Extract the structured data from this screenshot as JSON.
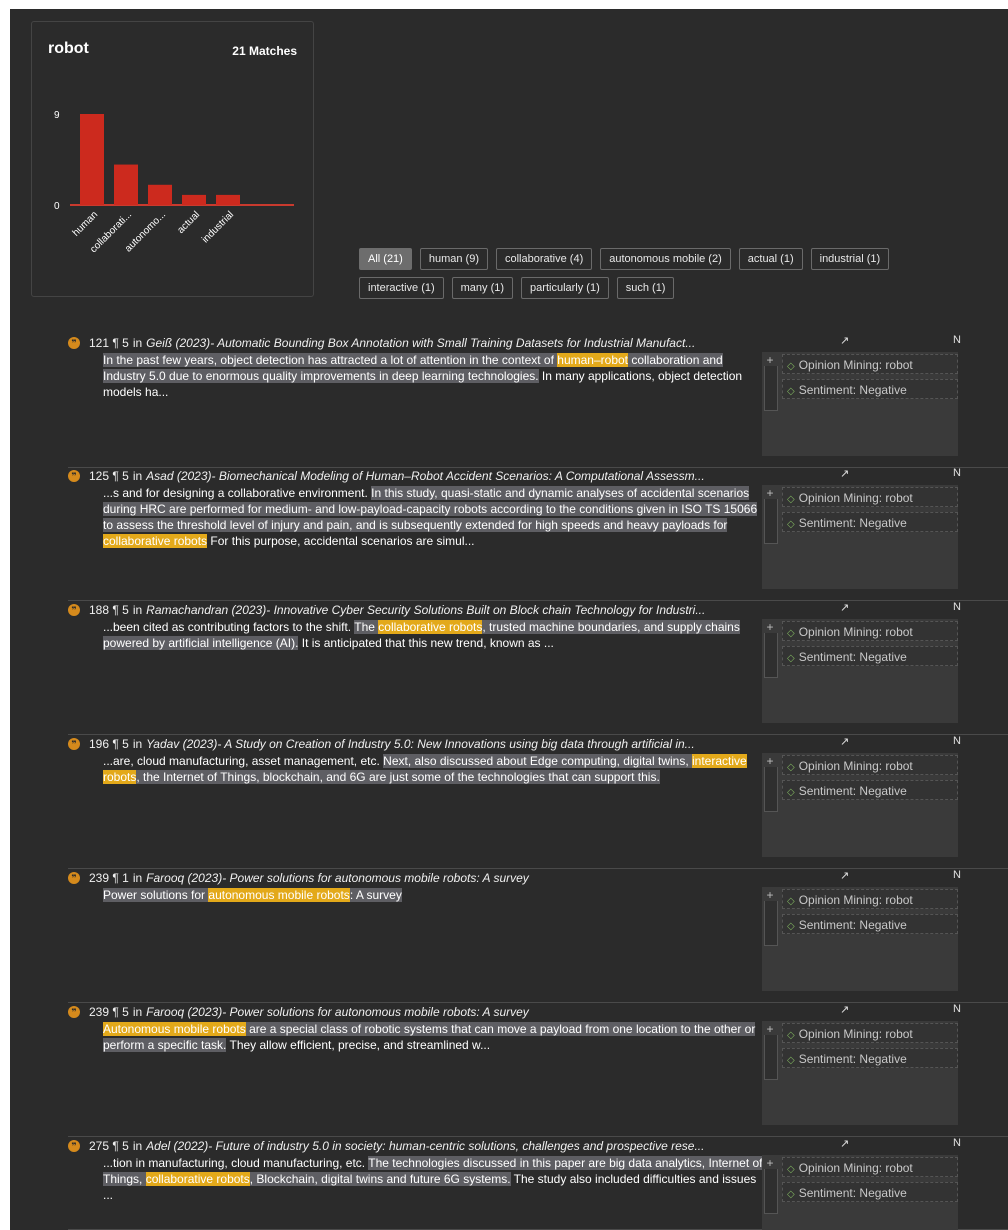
{
  "summary": {
    "term": "robot",
    "matches_label": "21 Matches",
    "chart_data": {
      "type": "bar",
      "categories": [
        "human",
        "collaborati...",
        "autonomo...",
        "actual",
        "industrial"
      ],
      "values": [
        9,
        4,
        2,
        1,
        1
      ],
      "ylim": [
        0,
        9
      ],
      "ytick_labels": [
        "0",
        "9"
      ],
      "bar_color": "#cc2a1e"
    }
  },
  "filters": {
    "rows": [
      [
        {
          "label": "All (21)",
          "active": true
        },
        {
          "label": "human (9)",
          "active": false
        },
        {
          "label": "collaborative (4)",
          "active": false
        },
        {
          "label": "autonomous mobile (2)",
          "active": false
        },
        {
          "label": "actual (1)",
          "active": false
        },
        {
          "label": "industrial (1)",
          "active": false
        }
      ],
      [
        {
          "label": "interactive (1)",
          "active": false
        },
        {
          "label": "many (1)",
          "active": false
        },
        {
          "label": "particularly (1)",
          "active": false
        },
        {
          "label": "such (1)",
          "active": false
        }
      ]
    ]
  },
  "colors": {
    "highlight": "#e3a91a",
    "context": "#5e5e63",
    "quote_icon": "#d58a1c",
    "tag_diamond": "#7fb35f"
  },
  "results": [
    {
      "ref": "121 ¶ 5",
      "in": "in",
      "author": "Geiß (2023)",
      "title": " - Automatic Bounding Box Annotation with Small Training Datasets for Industrial Manufact...",
      "arrow": "↗",
      "edge": "N",
      "segments": [
        {
          "t": "In the past few years, object detection has attracted a lot of attention in the context of ",
          "k": "ctx"
        },
        {
          "t": "human–robot",
          "k": "hl"
        },
        {
          "t": " collaboration and Industry 5.0 due to enormous quality improvements in deep learning technologies.",
          "k": "ctx"
        },
        {
          "t": " In many applications, object detection models ha...",
          "k": "plain"
        }
      ],
      "tags": [
        "Opinion Mining: robot",
        "Sentiment: Negative"
      ]
    },
    {
      "ref": "125 ¶ 5",
      "in": "in",
      "author": "Asad (2023)",
      "title": " - Biomechanical Modeling of Human–Robot Accident Scenarios: A Computational Assessm...",
      "arrow": "↗",
      "edge": "N",
      "segments": [
        {
          "t": "...s and for designing a collaborative environment. ",
          "k": "plain"
        },
        {
          "t": "In this study, quasi-static and dynamic analyses of accidental scenarios during HRC are performed for medium- and low-payload-capacity robots according to the conditions given in ISO TS 15066 to assess the threshold level of injury and pain, and is subsequently extended for high speeds and heavy payloads for ",
          "k": "ctx"
        },
        {
          "t": "collaborative robots",
          "k": "hl"
        },
        {
          "t": " For this purpose, accidental scenarios are simul...",
          "k": "plain"
        }
      ],
      "tags": [
        "Opinion Mining: robot",
        "Sentiment: Negative"
      ]
    },
    {
      "ref": "188 ¶ 5",
      "in": "in",
      "author": "Ramachandran (2023)",
      "title": " - Innovative Cyber Security Solutions Built on Block chain Technology for Industri...",
      "arrow": "↗",
      "edge": "N",
      "segments": [
        {
          "t": "...been cited as contributing factors to the shift. ",
          "k": "plain"
        },
        {
          "t": "The ",
          "k": "ctx"
        },
        {
          "t": "collaborative robots",
          "k": "hl"
        },
        {
          "t": ", trusted machine boundaries, and supply chains powered by artificial intelligence (AI).",
          "k": "ctx"
        },
        {
          "t": " It is anticipated that this new trend, known as ...",
          "k": "plain"
        }
      ],
      "tags": [
        "Opinion Mining: robot",
        "Sentiment: Negative"
      ]
    },
    {
      "ref": "196 ¶ 5",
      "in": "in",
      "author": "Yadav (2023)",
      "title": " - A Study on Creation of Industry 5.0: New Innovations using big data through artificial in...",
      "arrow": "↗",
      "edge": "N",
      "segments": [
        {
          "t": "...are, cloud manufacturing, asset management, etc. ",
          "k": "plain"
        },
        {
          "t": "Next, also discussed about Edge computing, digital twins, ",
          "k": "ctx"
        },
        {
          "t": "interactive robots",
          "k": "hl"
        },
        {
          "t": ", the Internet of Things, blockchain, and 6G are just some of the technologies that can support this.",
          "k": "ctx"
        }
      ],
      "tags": [
        "Opinion Mining: robot",
        "Sentiment: Negative"
      ]
    },
    {
      "ref": "239 ¶ 1",
      "in": "in",
      "author": "Farooq (2023)",
      "title": " - Power solutions for autonomous mobile robots: A survey",
      "arrow": "↗",
      "edge": "N",
      "segments": [
        {
          "t": "Power solutions for ",
          "k": "ctx"
        },
        {
          "t": "autonomous mobile robots",
          "k": "hl"
        },
        {
          "t": ": A survey",
          "k": "ctx"
        }
      ],
      "tags": [
        "Opinion Mining: robot",
        "Sentiment: Negative"
      ]
    },
    {
      "ref": "239 ¶ 5",
      "in": "in",
      "author": "Farooq (2023)",
      "title": " - Power solutions for autonomous mobile robots: A survey",
      "arrow": "↗",
      "edge": "N",
      "segments": [
        {
          "t": "Autonomous mobile robots",
          "k": "hl"
        },
        {
          "t": " are a special class of robotic systems that can move a payload from one location to the other or perform a specific task.",
          "k": "ctx"
        },
        {
          "t": " They allow efficient, precise, and streamlined w...",
          "k": "plain"
        }
      ],
      "tags": [
        "Opinion Mining: robot",
        "Sentiment: Negative"
      ]
    },
    {
      "ref": "275 ¶ 5",
      "in": "in",
      "author": "Adel (2022)",
      "title": " - Future of industry 5.0 in society: human-centric solutions, challenges and prospective rese...",
      "arrow": "↗",
      "edge": "N",
      "segments": [
        {
          "t": "...tion in manufacturing, cloud manufacturing, etc. ",
          "k": "plain"
        },
        {
          "t": "The technologies discussed in this paper are big data analytics, Internet of Things, ",
          "k": "ctx"
        },
        {
          "t": "collaborative robots",
          "k": "hl"
        },
        {
          "t": ", Blockchain, digital twins and future 6G systems.",
          "k": "ctx"
        },
        {
          "t": " The study also included difficulties and issues ...",
          "k": "plain"
        }
      ],
      "tags": [
        "Opinion Mining: robot",
        "Sentiment: Negative"
      ]
    }
  ]
}
